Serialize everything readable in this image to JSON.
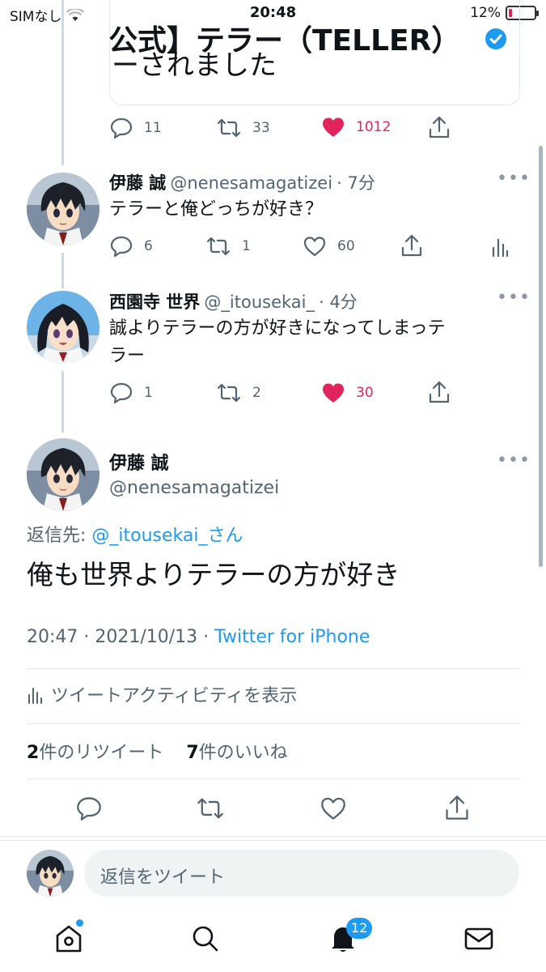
{
  "status_bar": {
    "carrier": "SIMなし",
    "time": "20:48",
    "battery_percent": "12%",
    "battery_level": 0.12
  },
  "quoted_tweet": {
    "line1": "公式】テラー（TELLER）",
    "line2": "ーされました"
  },
  "tweet1_actions": {
    "replies": "11",
    "retweets": "33",
    "likes": "1012"
  },
  "reply1": {
    "name": "伊藤 誠",
    "handle": "@nenesamagatizei",
    "time": "· 7分",
    "text": "テラーと俺どっちが好き？",
    "replies": "6",
    "retweets": "1",
    "likes": "60"
  },
  "reply2": {
    "name": "西園寺 世界",
    "handle": "@_itousekai_",
    "time": "· 4分",
    "text_line1": "誠よりテラーの方が好きになってしまっテ",
    "text_line2": "ラー",
    "replies": "1",
    "retweets": "2",
    "likes": "30"
  },
  "main_tweet": {
    "name": "伊藤 誠",
    "handle": "@nenesamagatizei",
    "reply_prefix": "返信先: ",
    "reply_to": "@_itousekai_さん",
    "text": "俺も世界よりテラーの方が好き",
    "timestamp": "20:47 · 2021/10/13 · ",
    "source": "Twitter for iPhone",
    "activity_label": "ツイートアクティビティを表示",
    "retweet_count": "2",
    "retweet_label": "件のリツイート",
    "like_count": "7",
    "like_label": "件のいいね"
  },
  "reply_bar": {
    "placeholder": "返信をツイート"
  },
  "tab_bar": {
    "notifications_badge": "12"
  },
  "colors": {
    "like": "#e0245e",
    "accent": "#1d9bf0",
    "muted": "#536471"
  }
}
